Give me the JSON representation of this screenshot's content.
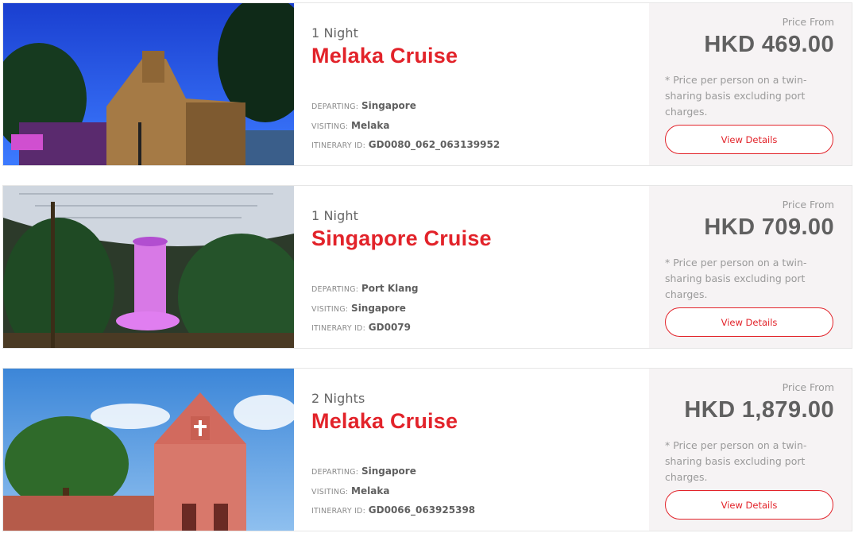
{
  "cruises": [
    {
      "nights": "1 Night",
      "title": "Melaka Cruise",
      "departing_label": "Departing:",
      "departing": "Singapore",
      "visiting_label": "Visiting:",
      "visiting": "Melaka",
      "itinerary_label": "Itinerary ID:",
      "itinerary_id": "GD0080_062_063139952",
      "price_from": "Price From",
      "price": "HKD 469.00",
      "note": "* Price per person on a twin-sharing basis excluding port charges.",
      "button": "View Details"
    },
    {
      "nights": "1 Night",
      "title": "Singapore Cruise",
      "departing_label": "Departing:",
      "departing": "Port Klang",
      "visiting_label": "Visiting:",
      "visiting": "Singapore",
      "itinerary_label": "Itinerary ID:",
      "itinerary_id": "GD0079",
      "price_from": "Price From",
      "price": "HKD 709.00",
      "note": "* Price per person on a twin-sharing basis excluding port charges.",
      "button": "View Details"
    },
    {
      "nights": "2 Nights",
      "title": "Melaka Cruise",
      "departing_label": "Departing:",
      "departing": "Singapore",
      "visiting_label": "Visiting:",
      "visiting": "Melaka",
      "itinerary_label": "Itinerary ID:",
      "itinerary_id": "GD0066_063925398",
      "price_from": "Price From",
      "price": "HKD 1,879.00",
      "note": "* Price per person on a twin-sharing basis excluding port charges.",
      "button": "View Details"
    }
  ],
  "colors": {
    "accent": "#e2232a",
    "price_panel": "#f6f3f4"
  }
}
